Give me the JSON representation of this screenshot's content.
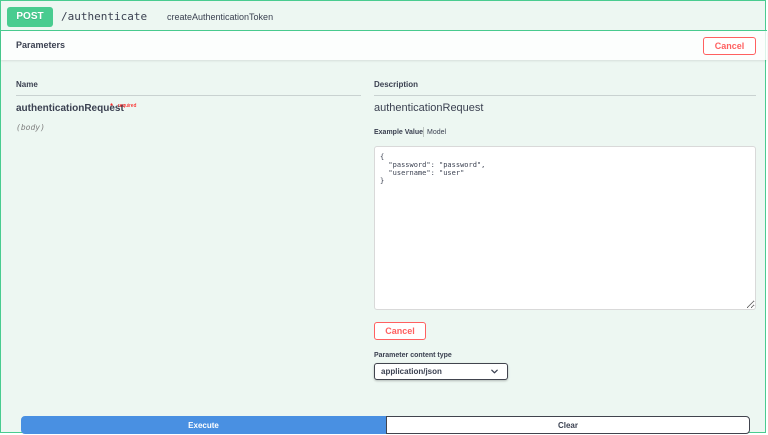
{
  "operation": {
    "method": "POST",
    "path": "/authenticate",
    "operation_id": "createAuthenticationToken"
  },
  "parameters_section": {
    "title": "Parameters",
    "cancel_label": "Cancel"
  },
  "table": {
    "name_header": "Name",
    "description_header": "Description"
  },
  "parameter": {
    "name": "authenticationRequest",
    "required_star": "*",
    "required_label": "required",
    "location": "(body)",
    "description": "authenticationRequest"
  },
  "example_tabs": {
    "example_value": "Example Value",
    "model": "Model"
  },
  "body_value": "{\n  \"password\": \"password\",\n  \"username\": \"user\"\n}",
  "body_cancel_label": "Cancel",
  "content_type": {
    "label": "Parameter content type",
    "selected": "application/json"
  },
  "actions": {
    "execute_label": "Execute",
    "clear_label": "Clear"
  },
  "colors": {
    "post_green": "#49cc90",
    "cancel_red": "#ff6060",
    "execute_blue": "#4990e2",
    "block_background": "#edf7f2"
  },
  "icons": {
    "select_arrow": "chevron-down-icon"
  }
}
